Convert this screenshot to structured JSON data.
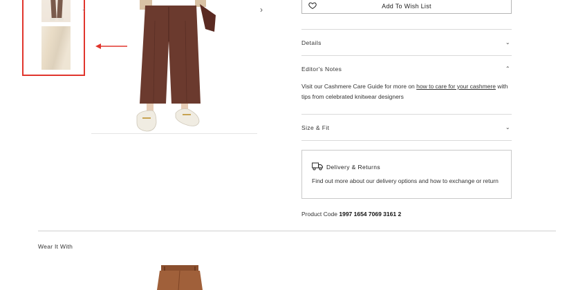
{
  "gallery": {
    "prev_chevron": "‹",
    "next_chevron": "›",
    "thumbnails": [
      {
        "icon": "model-trousers-thumbnail"
      },
      {
        "icon": "fabric-closeup-thumbnail"
      }
    ],
    "highlight_color": "#e0342c"
  },
  "wishlist": {
    "label": "Add To Wish List",
    "icon": "heart-icon"
  },
  "accordion": {
    "details": {
      "label": "Details",
      "chevron": "⌄"
    },
    "editors_notes": {
      "label": "Editor's Notes",
      "chevron": "⌃",
      "text_before": "Visit our Cashmere Care Guide for more on ",
      "link_text": "how to care for your cashmere",
      "text_after": " with",
      "text_line2": "tips from celebrated knitwear designers"
    },
    "size_fit": {
      "label": "Size & Fit",
      "chevron": "⌄"
    }
  },
  "delivery": {
    "icon": "truck-icon",
    "title": "Delivery & Returns",
    "description": "Find out more about our delivery options and how to exchange or return"
  },
  "product_code": {
    "label": "Product Code",
    "value": "1997 1654 7069 3161 2"
  },
  "wear_it_with": {
    "title": "Wear It With"
  }
}
